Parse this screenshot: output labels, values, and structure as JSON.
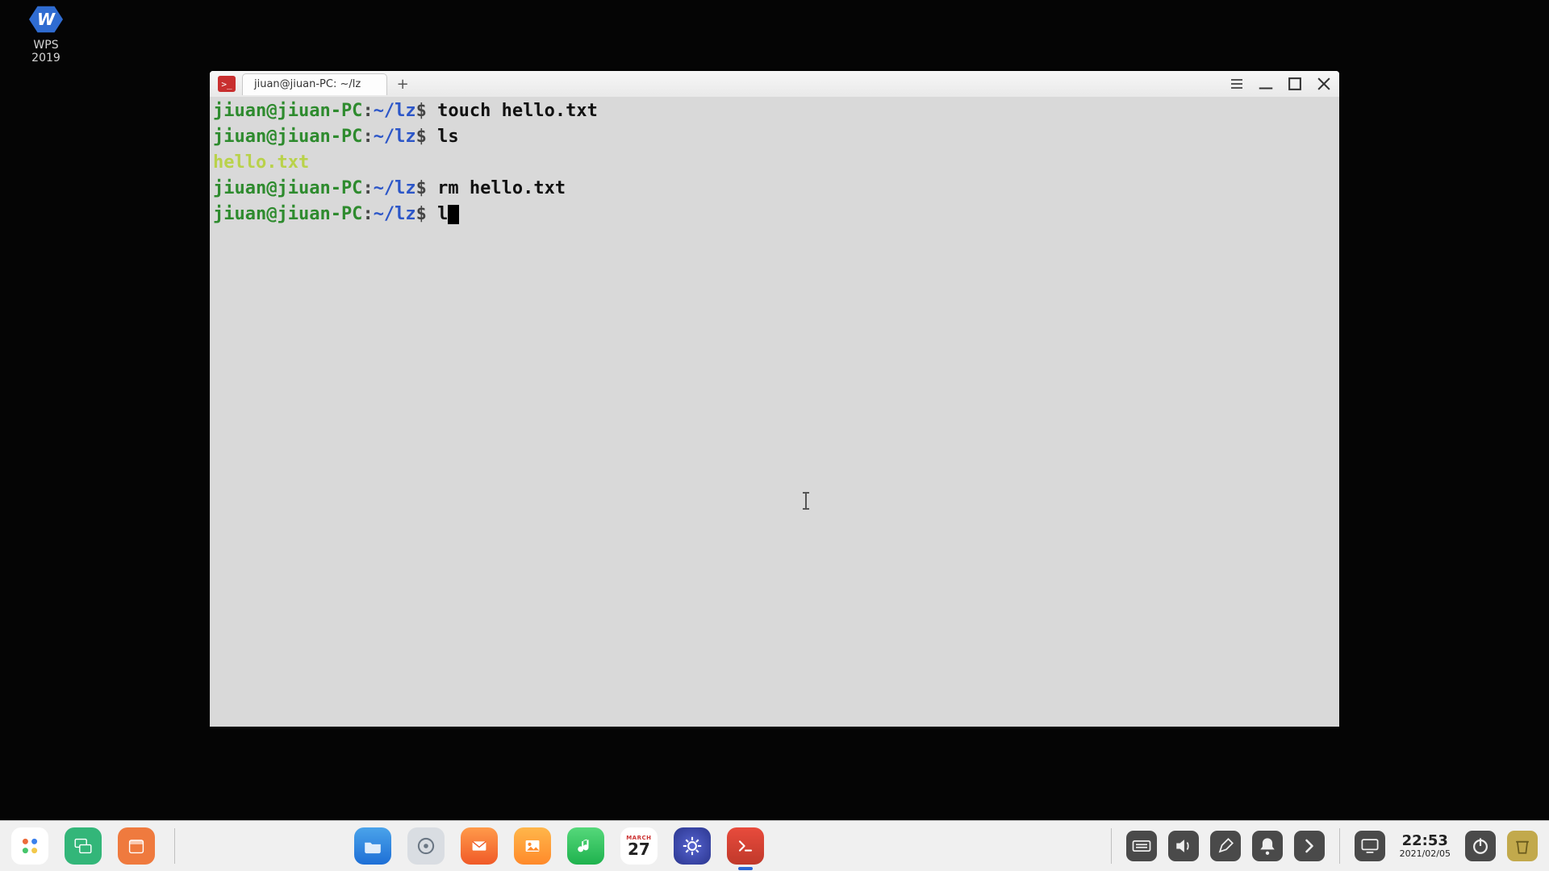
{
  "desktop": {
    "wps_label_line1": "WPS",
    "wps_label_line2": "2019",
    "wps_glyph": "W"
  },
  "window": {
    "tab_title": "jiuan@jiuan-PC: ~/lz",
    "app_badge_glyph": ">_",
    "new_tab_glyph": "+"
  },
  "terminal": {
    "prompt": {
      "userhost": "jiuan@jiuan-PC",
      "sep": ":",
      "path": "~/lz",
      "sigil": "$"
    },
    "lines": [
      {
        "cmd": "touch hello.txt"
      },
      {
        "cmd": "ls"
      },
      {
        "output": "hello.txt"
      },
      {
        "cmd": "rm hello.txt"
      },
      {
        "cmd": "l",
        "cursor": true
      }
    ]
  },
  "dock": {
    "calendar_month": "MARCH",
    "calendar_day": "27",
    "time": "22:53",
    "date": "2021/02/05"
  },
  "colors": {
    "window_bg": "#d9d9d9",
    "prompt_user": "#2e8b2e",
    "prompt_path": "#2c56c8",
    "ls_output": "#b9d24a"
  }
}
